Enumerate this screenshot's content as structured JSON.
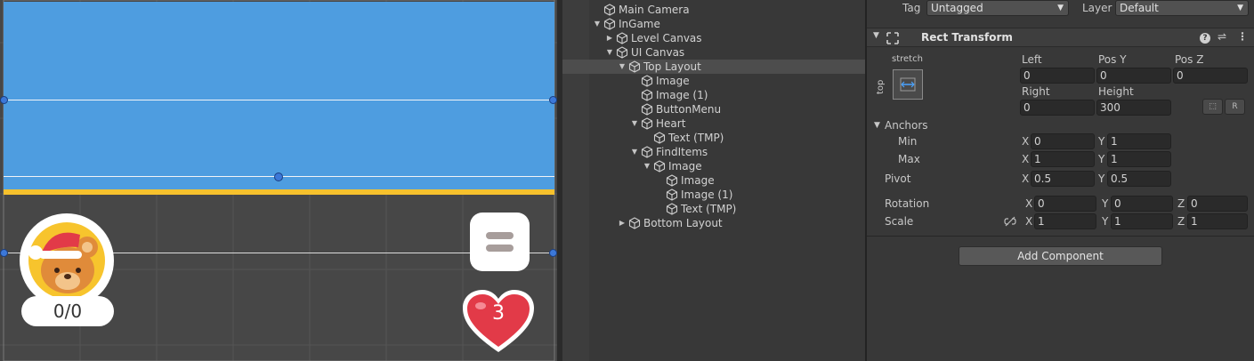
{
  "scene": {
    "counter_text": "0/0",
    "heart_count": "3",
    "colors": {
      "blue_panel": "#4e9de0",
      "stripe": "#f6c12d",
      "avatar": "#f7c42d",
      "heart": "#e23a48"
    }
  },
  "hierarchy": [
    {
      "label": "Main Camera",
      "depth": 1,
      "arrow": "",
      "selected": false
    },
    {
      "label": "InGame",
      "depth": 1,
      "arrow": "down",
      "selected": false
    },
    {
      "label": "Level Canvas",
      "depth": 2,
      "arrow": "right",
      "selected": false
    },
    {
      "label": "UI Canvas",
      "depth": 2,
      "arrow": "down",
      "selected": false
    },
    {
      "label": "Top Layout",
      "depth": 3,
      "arrow": "down",
      "selected": true
    },
    {
      "label": "Image",
      "depth": 4,
      "arrow": "",
      "selected": false
    },
    {
      "label": "Image (1)",
      "depth": 4,
      "arrow": "",
      "selected": false
    },
    {
      "label": "ButtonMenu",
      "depth": 4,
      "arrow": "",
      "selected": false
    },
    {
      "label": "Heart",
      "depth": 4,
      "arrow": "down",
      "selected": false
    },
    {
      "label": "Text (TMP)",
      "depth": 5,
      "arrow": "",
      "selected": false
    },
    {
      "label": "FindItems",
      "depth": 4,
      "arrow": "down",
      "selected": false
    },
    {
      "label": "Image",
      "depth": 5,
      "arrow": "down",
      "selected": false
    },
    {
      "label": "Image",
      "depth": 6,
      "arrow": "",
      "selected": false
    },
    {
      "label": "Image (1)",
      "depth": 6,
      "arrow": "",
      "selected": false
    },
    {
      "label": "Text (TMP)",
      "depth": 6,
      "arrow": "",
      "selected": false
    },
    {
      "label": "Bottom Layout",
      "depth": 3,
      "arrow": "right",
      "selected": false
    }
  ],
  "inspector": {
    "tag_label": "Tag",
    "tag_value": "Untagged",
    "layer_label": "Layer",
    "layer_value": "Default",
    "component_title": "Rect Transform",
    "anchor_preset_h": "stretch",
    "anchor_preset_v": "top",
    "left_label": "Left",
    "left_value": "0",
    "posy_label": "Pos Y",
    "posy_value": "0",
    "posz_label": "Pos Z",
    "posz_value": "0",
    "right_label": "Right",
    "right_value": "0",
    "height_label": "Height",
    "height_value": "300",
    "raw_button": "R",
    "anchors_label": "Anchors",
    "min_label": "Min",
    "min_x": "0",
    "min_y": "1",
    "max_label": "Max",
    "max_x": "1",
    "max_y": "1",
    "pivot_label": "Pivot",
    "pivot_x": "0.5",
    "pivot_y": "0.5",
    "rotation_label": "Rotation",
    "rot_x": "0",
    "rot_y": "0",
    "rot_z": "0",
    "scale_label": "Scale",
    "scale_x": "1",
    "scale_y": "1",
    "scale_z": "1",
    "axis_x": "X",
    "axis_y": "Y",
    "axis_z": "Z",
    "add_component": "Add Component"
  }
}
